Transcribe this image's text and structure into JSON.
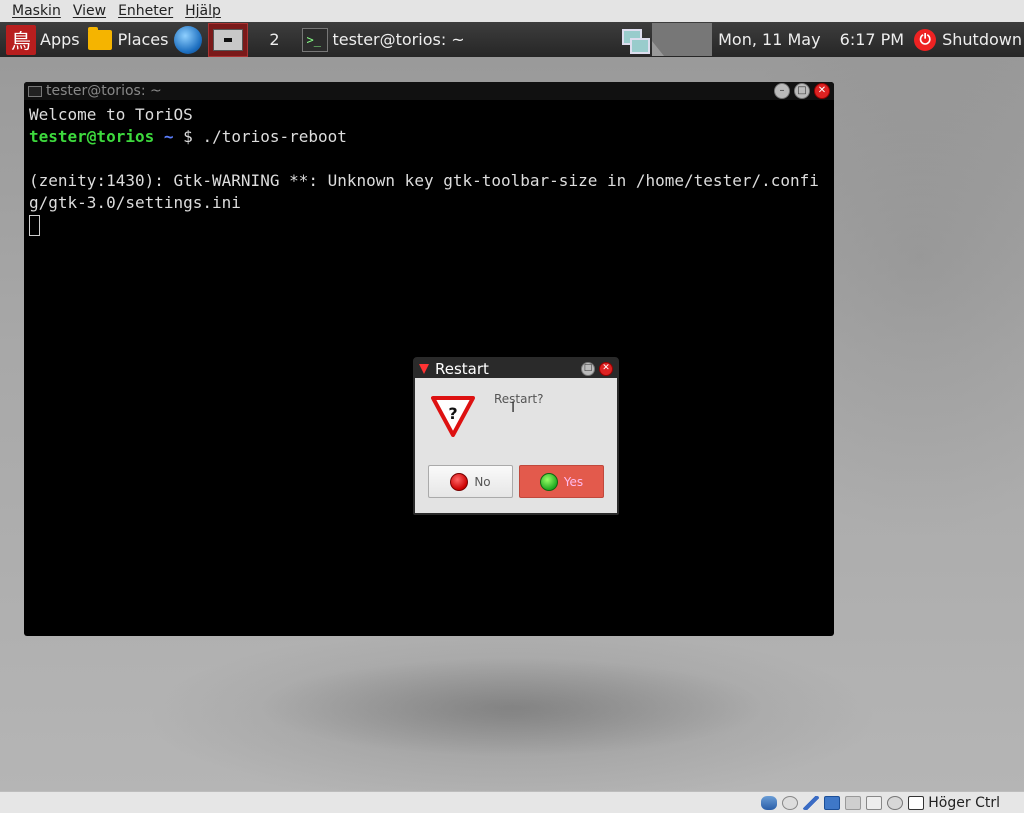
{
  "vbox_menu": [
    "Maskin",
    "View",
    "Enheter",
    "Hjälp"
  ],
  "panel": {
    "apps_label": "Apps",
    "places_label": "Places",
    "workspace_number": "2",
    "task_title": "tester@torios: ~",
    "clock_date": "Mon, 11 May",
    "clock_time": "6:17 PM",
    "shutdown_label": "Shutdown",
    "logo_glyph": "鳥"
  },
  "terminal": {
    "title": "tester@torios: ~",
    "welcome": "Welcome to ToriOS",
    "prompt_user": "tester@torios",
    "prompt_path": "~",
    "prompt_symbol": "$",
    "command": "./torios-reboot",
    "warning": "(zenity:1430): Gtk-WARNING **: Unknown key gtk-toolbar-size in /home/tester/.config/gtk-3.0/settings.ini"
  },
  "dialog": {
    "title": "Restart",
    "question": "Restart?",
    "no_label": "No",
    "yes_label": "Yes"
  },
  "status": {
    "host_key": "Höger Ctrl"
  }
}
